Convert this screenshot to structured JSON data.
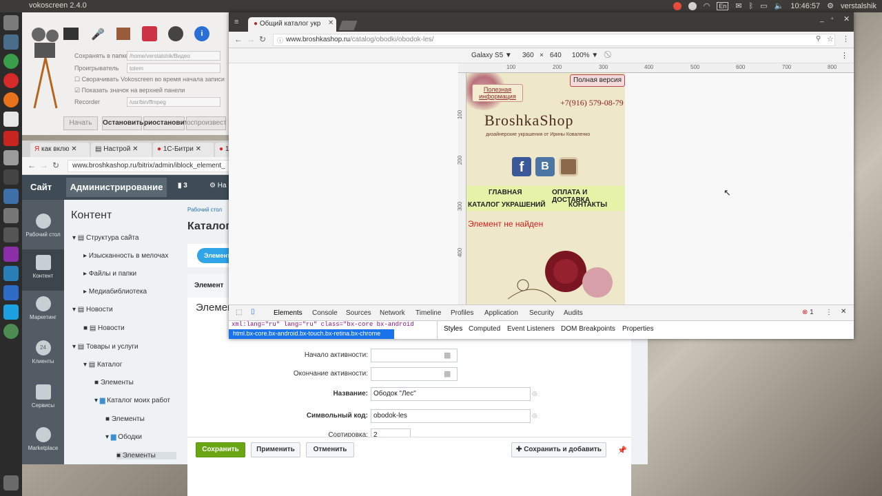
{
  "system": {
    "app_title": "vokoscreen 2.4.0",
    "tray": {
      "lang": "En",
      "clock": "10:46:57",
      "user": "verstalshik"
    }
  },
  "vokoscreen": {
    "rows": [
      {
        "label": "Сохранять в папке",
        "value": "/home/verstalshik/Видео"
      },
      {
        "label": "Проигрыватель",
        "value": "totem"
      },
      {
        "label": "Recorder",
        "value": "/usr/bin/ffmpeg"
      }
    ],
    "checks": [
      "Сворачивать Vokoscreen во время начала записи",
      "Показать значок на верхней панели"
    ],
    "buttons": [
      "Начать",
      "Остановить",
      "риостановит",
      "оспроизвест"
    ]
  },
  "bitrix": {
    "tabs": [
      "как вклю",
      "Настрой",
      "1С-Битри",
      "1С"
    ],
    "url": "www.broshkashop.ru/bitrix/admin/iblock_element_",
    "head": {
      "site": "Сайт",
      "admin": "Администрирование",
      "notify": "3",
      "settings": "На"
    },
    "side": [
      {
        "label": "Рабочий стол",
        "icon": "home-icon"
      },
      {
        "label": "Контент",
        "icon": "content-icon"
      },
      {
        "label": "Маркетинг",
        "icon": "target-icon"
      },
      {
        "label": "Клиенты",
        "icon": "clients-icon",
        "badge": "24"
      },
      {
        "label": "Сервисы",
        "icon": "layers-icon"
      },
      {
        "label": "Marketplace",
        "icon": "cloud-icon"
      }
    ],
    "section_title": "Контент",
    "tree": [
      "Структура сайта",
      "Изысканность в мелочах",
      "Файлы и папки",
      "Медиабиблиотека",
      "Новости",
      "Новости",
      "Товары и услуги",
      "Каталог",
      "Элементы",
      "Каталог моих работ",
      "Элементы",
      "Ободки",
      "Элементы"
    ],
    "breadcrumb": "Рабочий стол",
    "page_title": "Каталог",
    "tab_label": "Элемент",
    "tab2": "Элемент",
    "heading": "Элемен",
    "fields": [
      {
        "label": "Начало активности:",
        "value": ""
      },
      {
        "label": "Окончание активности:",
        "value": ""
      },
      {
        "label": "Название:",
        "value": "Ободок \"Лес\""
      },
      {
        "label": "Символьный код:",
        "value": "obodok-les"
      },
      {
        "label": "Сортировка:",
        "value": "2"
      }
    ],
    "footer": {
      "save": "Сохранить",
      "apply": "Применить",
      "cancel": "Отменить",
      "save_add": "Сохранить и добавить"
    }
  },
  "chrome": {
    "tab": "Общий каталог укр",
    "url_host": "www.broshkashop.ru",
    "url_path": "/catalog/obodki/obodok-les/",
    "device": {
      "name": "Galaxy S5",
      "width": "360",
      "x": "×",
      "height": "640",
      "zoom": "100%"
    },
    "ruler": [
      "100",
      "200",
      "300",
      "400",
      "500",
      "600",
      "700",
      "800"
    ],
    "vruler": [
      "100",
      "200",
      "300",
      "400"
    ],
    "site": {
      "useful": "Полезная информация",
      "full": "Полная версия",
      "phone": "+7(916) 579-08-79",
      "logo": "BroshkaShop",
      "tagline": "дизайнерские украшения от Ирины Коваленко",
      "menu": [
        "ГЛАВНАЯ",
        "ОПЛАТА И ДОСТАВКА",
        "КАТАЛОГ УКРАШЕНИЙ",
        "КОНТАКТЫ"
      ],
      "error": "Элемент не найден"
    },
    "devtools": {
      "tabs": [
        "Elements",
        "Console",
        "Sources",
        "Network",
        "Timeline",
        "Profiles",
        "Application",
        "Security",
        "Audits"
      ],
      "errors": "1",
      "code": "xml:lang=\"ru\" lang=\"ru\" class=\"bx-core bx-android",
      "breadcrumb": "html.bx-core.bx-android.bx-touch.bx-retina.bx-chrome",
      "subtabs": [
        "Styles",
        "Computed",
        "Event Listeners",
        "DOM Breakpoints",
        "Properties"
      ]
    }
  },
  "colors": {
    "accent_green": "#6aa514",
    "bx_header": "#3f4c56",
    "bx_blue": "#2fa4e7",
    "error_red": "#d22020",
    "tray_red": "#e74c3c"
  }
}
